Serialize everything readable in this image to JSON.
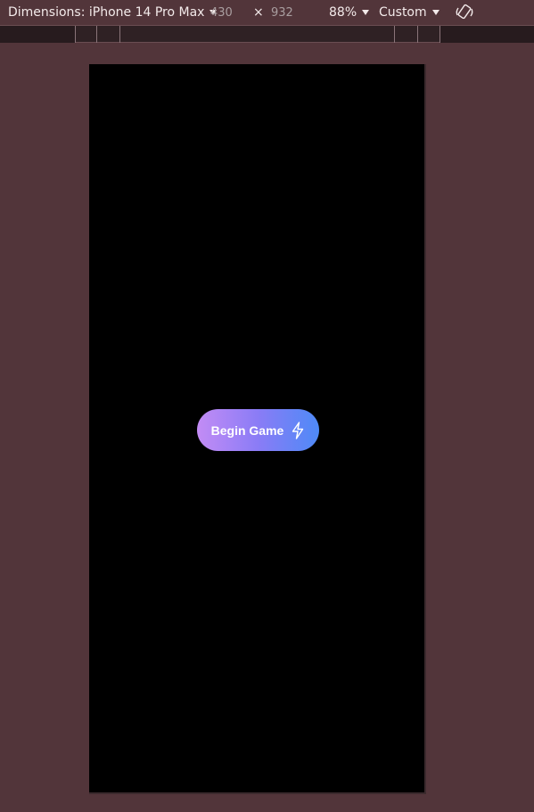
{
  "toolbar": {
    "dimensions_label": "Dimensions: iPhone 14 Pro Max",
    "width_value": "430",
    "times_symbol": "×",
    "height_value": "932",
    "zoom": "88%",
    "throttle": "Custom",
    "rotate_icon": "rotate-icon"
  },
  "device_screen": {
    "background_color": "#000000",
    "button_label": "Begin Game",
    "button_icon": "lightning-bolt-icon",
    "gradient_start": "#c38cf5",
    "gradient_end": "#4e8af7"
  }
}
